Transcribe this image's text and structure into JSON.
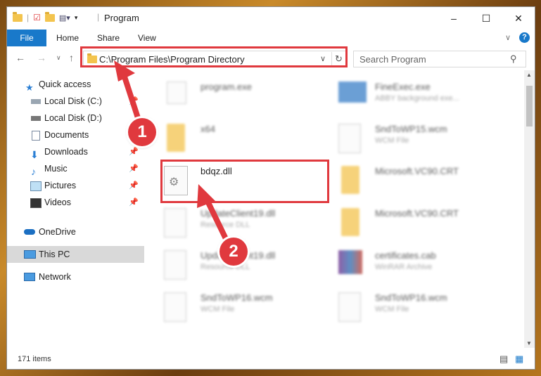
{
  "window": {
    "title": "Program"
  },
  "ribbon": {
    "file": "File",
    "home": "Home",
    "share": "Share",
    "view": "View",
    "help": "?"
  },
  "address": {
    "path": "C:\\Program Files\\Program Directory",
    "search_placeholder": "Search Program"
  },
  "nav": {
    "items": [
      {
        "label": "Quick access"
      },
      {
        "label": "Local Disk (C:)"
      },
      {
        "label": "Local Disk (D:)"
      },
      {
        "label": "Documents"
      },
      {
        "label": "Downloads"
      },
      {
        "label": "Music"
      },
      {
        "label": "Pictures"
      },
      {
        "label": "Videos"
      },
      {
        "label": "OneDrive"
      },
      {
        "label": "This PC"
      },
      {
        "label": "Network"
      }
    ]
  },
  "files": [
    {
      "name": "program.exe",
      "sub": ""
    },
    {
      "name": "FineExec.exe",
      "sub": "ABBY background exe..."
    },
    {
      "name": "x64",
      "sub": ""
    },
    {
      "name": "SndToWP15.wcm",
      "sub": "WCM File"
    },
    {
      "name": "bdqz.dll",
      "sub": ""
    },
    {
      "name": "Microsoft.VC90.CRT",
      "sub": ""
    },
    {
      "name": "UpdateClient19.dll",
      "sub": "Resource DLL"
    },
    {
      "name": "Microsoft.VC90.CRT",
      "sub": ""
    },
    {
      "name": "UpdateClient19.dll",
      "sub": "Resource DLL"
    },
    {
      "name": "certificates.cab",
      "sub": "WinRAR Archive"
    },
    {
      "name": "SndToWP16.wcm",
      "sub": "WCM File"
    },
    {
      "name": "SndToWP16.wcm",
      "sub": "WCM File"
    }
  ],
  "status": {
    "count": "171 items"
  },
  "annotations": {
    "step1": "1",
    "step2": "2"
  },
  "colors": {
    "accent": "#1979ca",
    "highlight": "#e0393e"
  }
}
